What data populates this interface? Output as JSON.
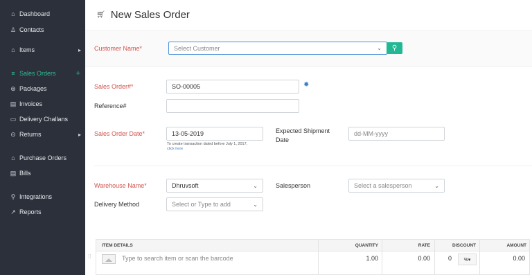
{
  "sidebar": {
    "items": [
      {
        "label": "Dashboard",
        "icon": "home-icon",
        "glyph": "⌂"
      },
      {
        "label": "Contacts",
        "icon": "user-icon",
        "glyph": "♙"
      },
      {
        "label": "Items",
        "icon": "items-icon",
        "glyph": "⌂"
      },
      {
        "label": "Sales Orders",
        "icon": "cart-icon",
        "glyph": "≡"
      },
      {
        "label": "Packages",
        "icon": "package-icon",
        "glyph": "⊛"
      },
      {
        "label": "Invoices",
        "icon": "invoice-icon",
        "glyph": "▤"
      },
      {
        "label": "Delivery Challans",
        "icon": "truck-icon",
        "glyph": "▭"
      },
      {
        "label": "Returns",
        "icon": "returns-icon",
        "glyph": "⊙"
      },
      {
        "label": "Purchase Orders",
        "icon": "purchase-icon",
        "glyph": "⌂"
      },
      {
        "label": "Bills",
        "icon": "bill-icon",
        "glyph": "▤"
      },
      {
        "label": "Integrations",
        "icon": "integrations-icon",
        "glyph": "⚲"
      },
      {
        "label": "Reports",
        "icon": "reports-icon",
        "glyph": "↗"
      }
    ],
    "active_color": "#2ebf91",
    "bg_color": "#2b303b"
  },
  "header": {
    "title": "New Sales Order"
  },
  "form": {
    "customer_name_label": "Customer Name*",
    "customer_placeholder": "Select Customer",
    "sales_order_label": "Sales Order#*",
    "sales_order_value": "SO-00005",
    "reference_label": "Reference#",
    "reference_value": "",
    "sales_order_date_label": "Sales Order Date*",
    "sales_order_date_value": "13-05-2019",
    "date_hint": "To create transaction dated before July 1, 2017,",
    "date_hint_link": "click here",
    "expected_shipment_label_1": "Expected Shipment",
    "expected_shipment_label_2": "Date",
    "expected_shipment_placeholder": "dd-MM-yyyy",
    "warehouse_label": "Warehouse Name*",
    "warehouse_value": "Dhruvsoft",
    "salesperson_label": "Salesperson",
    "salesperson_placeholder": "Select a salesperson",
    "delivery_method_label": "Delivery Method",
    "delivery_method_placeholder": "Select or Type to add"
  },
  "items_table": {
    "headers": {
      "item_details": "ITEM DETAILS",
      "quantity": "QUANTITY",
      "rate": "RATE",
      "discount": "DISCOUNT",
      "amount": "AMOUNT"
    },
    "row": {
      "item_placeholder": "Type to search item or scan the barcode",
      "quantity": "1.00",
      "rate": "0.00",
      "discount": "0",
      "discount_unit": "%▾",
      "amount": "0.00"
    }
  },
  "colors": {
    "required": "#d2524b",
    "accent": "#21b894",
    "link": "#3e7fc1"
  }
}
